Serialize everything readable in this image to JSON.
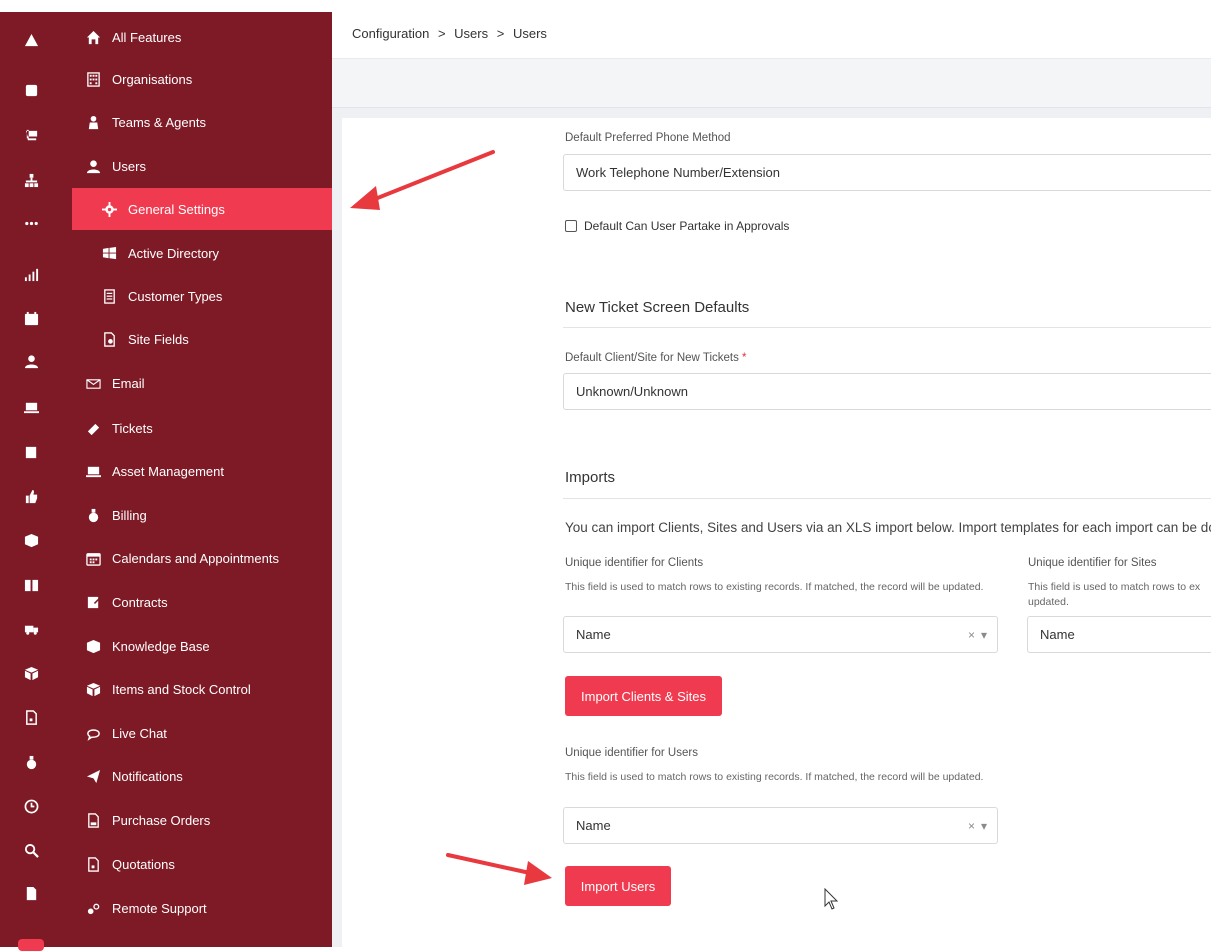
{
  "breadcrumb": {
    "items": [
      "Configuration",
      "Users",
      "Users"
    ],
    "separator": ">"
  },
  "rail_icons": [
    "warning-icon",
    "edit-icon",
    "cart-icon",
    "hierarchy-icon",
    "more-icon",
    "chart-icon",
    "calendar-icon",
    "user-icon",
    "laptop-icon",
    "contract-icon",
    "thumbs-up-icon",
    "box-icon",
    "book-icon",
    "truck-icon",
    "cube-icon",
    "quote-doc-icon",
    "money-bag-icon",
    "clock-icon",
    "search-icon",
    "document-icon"
  ],
  "sidebar": {
    "items": [
      {
        "label": "All Features",
        "icon": "home-icon"
      },
      {
        "label": "Organisations",
        "icon": "building-icon"
      },
      {
        "label": "Teams & Agents",
        "icon": "team-icon"
      },
      {
        "label": "Users",
        "icon": "user-icon"
      },
      {
        "label": "General Settings",
        "icon": "gear-icon"
      },
      {
        "label": "Active Directory",
        "icon": "windows-icon"
      },
      {
        "label": "Customer Types",
        "icon": "list-doc-icon"
      },
      {
        "label": "Site Fields",
        "icon": "site-field-icon"
      },
      {
        "label": "Email",
        "icon": "envelope-icon"
      },
      {
        "label": "Tickets",
        "icon": "ticket-icon"
      },
      {
        "label": "Asset Management",
        "icon": "laptop-icon"
      },
      {
        "label": "Billing",
        "icon": "money-bag-icon"
      },
      {
        "label": "Calendars and Appointments",
        "icon": "calendar-icon"
      },
      {
        "label": "Contracts",
        "icon": "contract-icon"
      },
      {
        "label": "Knowledge Base",
        "icon": "box-icon"
      },
      {
        "label": "Items and Stock Control",
        "icon": "cube-icon"
      },
      {
        "label": "Live Chat",
        "icon": "chat-icon"
      },
      {
        "label": "Notifications",
        "icon": "paper-plane-icon"
      },
      {
        "label": "Purchase Orders",
        "icon": "po-doc-icon"
      },
      {
        "label": "Quotations",
        "icon": "quote-doc-icon"
      },
      {
        "label": "Remote Support",
        "icon": "remote-icon"
      }
    ],
    "active_index": 4
  },
  "form": {
    "phone_method_label": "Default Preferred Phone Method",
    "phone_method_value": "Work Telephone Number/Extension",
    "approvals_checkbox_label": "Default Can User Partake in Approvals",
    "approvals_checked": false,
    "new_ticket_section_title": "New Ticket Screen Defaults",
    "default_client_site_label": "Default Client/Site for New Tickets",
    "required_marker": "*",
    "default_client_site_value": "Unknown/Unknown",
    "imports_section_title": "Imports",
    "imports_description": "You can import Clients, Sites and Users via an XLS import below. Import templates for each import can be dow",
    "clients_identifier_label": "Unique identifier for Clients",
    "clients_identifier_help": "This field is used to match rows to existing records. If matched, the record will be updated.",
    "clients_identifier_value": "Name",
    "sites_identifier_label": "Unique identifier for Sites",
    "sites_identifier_help_line1": "This field is used to match rows to ex",
    "sites_identifier_help_line2": "updated.",
    "sites_identifier_value": "Name",
    "import_clients_button": "Import Clients & Sites",
    "users_identifier_label": "Unique identifier for Users",
    "users_identifier_help": "This field is used to match rows to existing records. If matched, the record will be updated.",
    "users_identifier_value": "Name",
    "import_users_button": "Import Users",
    "clear_glyph": "×",
    "dropdown_glyph": "▾"
  },
  "colors": {
    "sidebar_bg": "#7d1a26",
    "accent": "#f03a4f",
    "annotation_arrow": "#e8393f"
  }
}
